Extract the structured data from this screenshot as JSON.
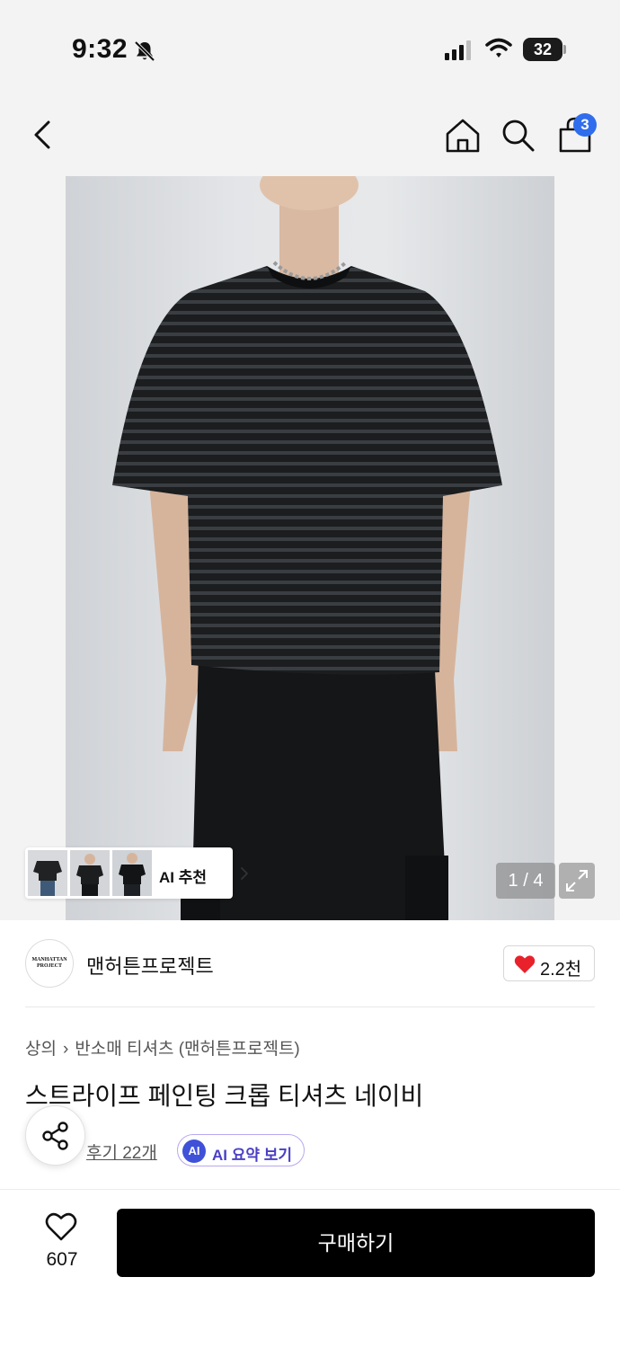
{
  "status_bar": {
    "time": "9:32",
    "battery": "32",
    "icons": [
      "bell-slash-icon",
      "signal-icon",
      "wifi-icon",
      "battery-icon"
    ]
  },
  "nav": {
    "icons": [
      "back-chevron-icon",
      "home-icon",
      "search-icon",
      "shopping-bag-icon"
    ],
    "cart_count": "3"
  },
  "gallery": {
    "ai_recommend_label": "AI 추천",
    "page_indicator": "1 / 4",
    "expand_icon": "expand-icon"
  },
  "brand": {
    "logo_text_line1": "MANHATTAN",
    "logo_text_line2": "PROJECT",
    "name": "맨허튼프로젝트",
    "like_count": "2.2천"
  },
  "product": {
    "breadcrumb_category": "상의",
    "breadcrumb_sub": "반소매 티셔츠 (맨허튼프로젝트)",
    "title": "스트라이프 페인팅 크롭 티셔츠 네이비",
    "reviews_label": "후기 22개",
    "ai_badge": "AI",
    "ai_summary_label": "AI 요약 보기"
  },
  "bottom_bar": {
    "like_count": "607",
    "buy_label": "구매하기"
  },
  "colors": {
    "accent_blue": "#2f6ded",
    "heart_red": "#e8212b",
    "ai_purple": "#4a3fc4",
    "buy_button": "#000000"
  }
}
